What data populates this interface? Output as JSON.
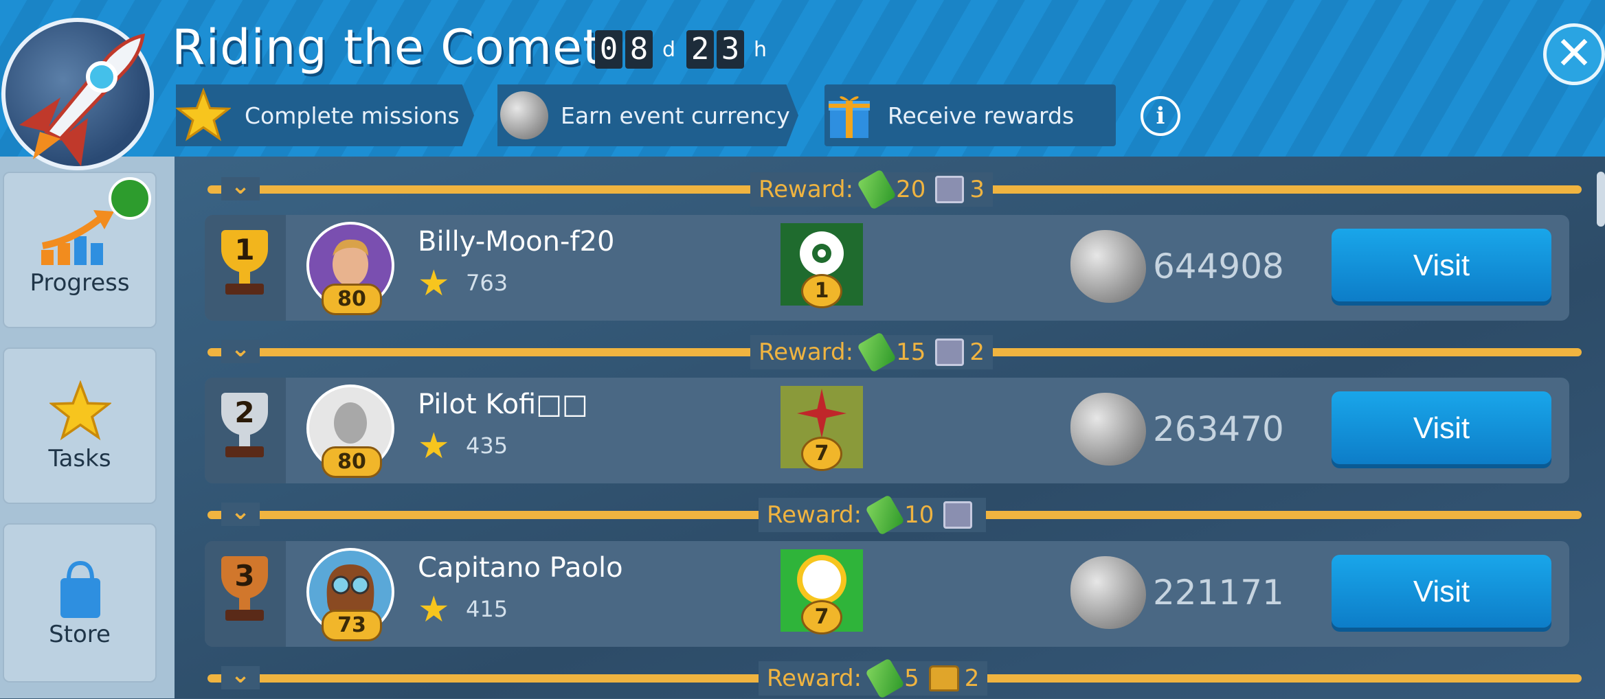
{
  "event": {
    "title": "Riding the Comet",
    "timer": {
      "days": [
        "0",
        "8"
      ],
      "day_unit": "d",
      "hours": [
        "2",
        "3"
      ],
      "hour_unit": "h"
    },
    "steps": [
      {
        "label": "Complete missions",
        "icon": "star-icon"
      },
      {
        "label": "Earn event currency",
        "icon": "asteroid-icon"
      },
      {
        "label": "Receive rewards",
        "icon": "gift-icon"
      }
    ],
    "info_icon": "info-icon",
    "close_icon": "close-icon"
  },
  "sidebar": {
    "items": [
      {
        "label": "Progress",
        "icon": "progress-chart-icon"
      },
      {
        "label": "Tasks",
        "icon": "star-icon"
      },
      {
        "label": "Store",
        "icon": "shopping-bag-icon"
      }
    ]
  },
  "rewards": [
    {
      "label": "Reward:",
      "items": [
        {
          "icon": "cash-icon",
          "count": "20"
        },
        {
          "icon": "crate-icon",
          "count": "3"
        }
      ]
    },
    {
      "label": "Reward:",
      "items": [
        {
          "icon": "cash-icon",
          "count": "15"
        },
        {
          "icon": "crate-icon",
          "count": "2"
        }
      ]
    },
    {
      "label": "Reward:",
      "items": [
        {
          "icon": "cash-icon",
          "count": "10"
        },
        {
          "icon": "crate-icon",
          "count": ""
        }
      ]
    },
    {
      "label": "Reward:",
      "items": [
        {
          "icon": "cash-icon",
          "count": "5"
        },
        {
          "icon": "chest-icon",
          "count": "2"
        }
      ]
    }
  ],
  "leaderboard": [
    {
      "rank": "1",
      "name": "Billy-Moon-f20",
      "level": "80",
      "stars": "763",
      "emblem_level": "1",
      "currency": "644908",
      "action": "Visit"
    },
    {
      "rank": "2",
      "name": "Pilot Kofi□□",
      "level": "80",
      "stars": "435",
      "emblem_level": "7",
      "currency": "263470",
      "action": "Visit"
    },
    {
      "rank": "3",
      "name": "Capitano Paolo",
      "level": "73",
      "stars": "415",
      "emblem_level": "7",
      "currency": "221171",
      "action": "Visit"
    }
  ]
}
